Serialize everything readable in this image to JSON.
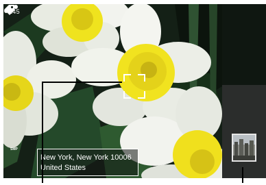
{
  "viewfinder": {
    "shot_count": "245",
    "location": {
      "line1": "New York, New York 10006",
      "line2": "United States"
    },
    "smp_label": "SMP"
  },
  "icons": {
    "focus": "focus-frame-icon",
    "tag": "tag-icon",
    "geotag_dots": "dots-icon",
    "thumbnail": "gallery-thumbnail-icon"
  },
  "colors": {
    "overlay_text": "#ffffff",
    "petal": "#eef0e8",
    "corona": "#f2e21c",
    "foliage": "#1f3a22"
  }
}
